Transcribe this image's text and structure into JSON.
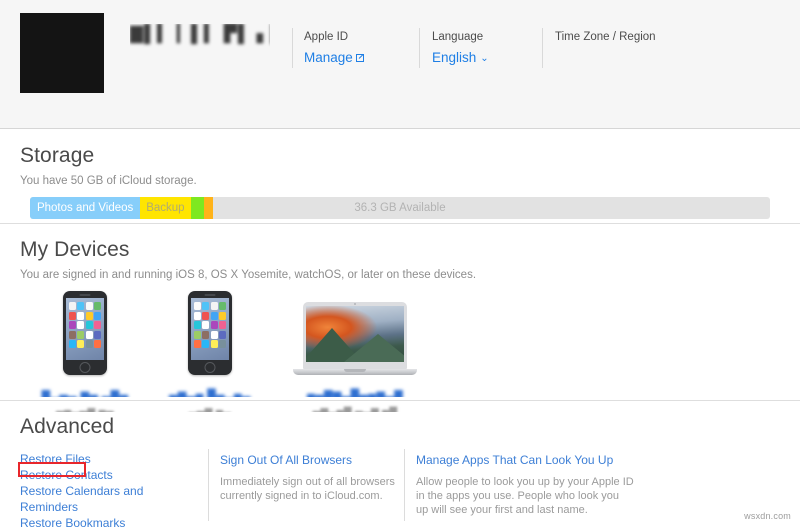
{
  "header": {
    "avatar": "redacted-profile-photo",
    "account_name": "▇▌▍ ▎▌▍ ▛▌ ▖▌",
    "columns": [
      {
        "label": "Apple ID",
        "link": "Manage",
        "icon": "external-link-icon"
      },
      {
        "label": "Language",
        "link": "English",
        "icon": "chevron-down-icon"
      },
      {
        "label": "Time Zone / Region",
        "link": "",
        "icon": ""
      }
    ]
  },
  "storage": {
    "title": "Storage",
    "subtitle": "You have 50 GB of iCloud storage.",
    "available_label": "36.3 GB Available",
    "segments": [
      {
        "label": "Photos and Videos",
        "color": "#87cefa",
        "width_pct": 14.9
      },
      {
        "label": "Backup",
        "color": "#ffe500",
        "width_pct": 6.8
      },
      {
        "label": "",
        "color": "#7ee820",
        "width_pct": 1.8
      },
      {
        "label": "",
        "color": "#ffb319",
        "width_pct": 1.2
      }
    ],
    "track_color": "#e2e2e2"
  },
  "devices": {
    "title": "My Devices",
    "subtitle": "You are signed in and running iOS 8, OS X Yosemite, watchOS, or later on these devices.",
    "items": [
      {
        "art": "iphone",
        "name": "▆▁▃▂ ▅▃ ▂▆▃",
        "model": "▃▄▂▃▅ ▄▃"
      },
      {
        "art": "iphone",
        "name": "▃▅▂▄ ▇▃▁▄▂",
        "model": "▂▃▅ ▄▂"
      },
      {
        "art": "macbook",
        "name": "▄▃▆▅▂▇▃▄▅▂▆",
        "model": "▃▅▂▄▆ ▃▂▅ ▄▆"
      }
    ]
  },
  "advanced": {
    "title": "Advanced",
    "restore_links": [
      "Restore Files",
      "Restore Contacts",
      "Restore Calendars and Reminders",
      "Restore Bookmarks"
    ],
    "sign_out": {
      "link": "Sign Out Of All Browsers",
      "description": "Immediately sign out of all browsers currently signed in to iCloud.com."
    },
    "look_up": {
      "link": "Manage Apps That Can Look You Up",
      "description": "Allow people to look you up by your Apple ID in the apps you use. People who look you up will see your first and last name."
    },
    "highlight_color": "#e8262b",
    "highlighted_item": "Restore Files"
  },
  "watermark": "wsxdn.com"
}
